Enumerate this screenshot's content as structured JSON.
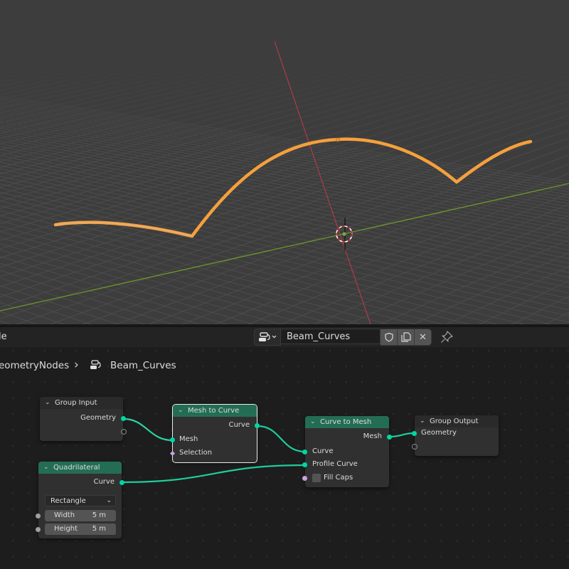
{
  "viewport": {
    "object_color": "#f5a03c",
    "x_axis_color": "#b03a48",
    "y_axis_color": "#6a9a2a"
  },
  "header": {
    "editor_mode_partial": "le",
    "node_tree_name": "Beam_Curves",
    "fake_user_icon": "shield-icon",
    "duplicate_icon": "duplicate-icon",
    "unlink_label": "✕",
    "pin_icon": "pin-icon"
  },
  "breadcrumb": {
    "parent": "eometryNodes",
    "separator": "›",
    "current": "Beam_Curves"
  },
  "nodes": {
    "group_input": {
      "title": "Group Input",
      "outputs": [
        "Geometry"
      ]
    },
    "mesh_to_curve": {
      "title": "Mesh to Curve",
      "outputs": [
        "Curve"
      ],
      "inputs": [
        "Mesh",
        "Selection"
      ]
    },
    "curve_to_mesh": {
      "title": "Curve to Mesh",
      "outputs": [
        "Mesh"
      ],
      "inputs": [
        "Curve",
        "Profile Curve"
      ],
      "fill_caps_label": "Fill Caps",
      "fill_caps_checked": false
    },
    "group_output": {
      "title": "Group Output",
      "inputs": [
        "Geometry"
      ]
    },
    "quadrilateral": {
      "title": "Quadrilateral",
      "outputs": [
        "Curve"
      ],
      "mode": "Rectangle",
      "width_label": "Width",
      "width_value": "5 m",
      "height_label": "Height",
      "height_value": "5 m"
    }
  },
  "colors": {
    "geometry_socket": "#00d6a3",
    "node_header_green": "#246d55",
    "field_socket": "#c8a2e0"
  }
}
